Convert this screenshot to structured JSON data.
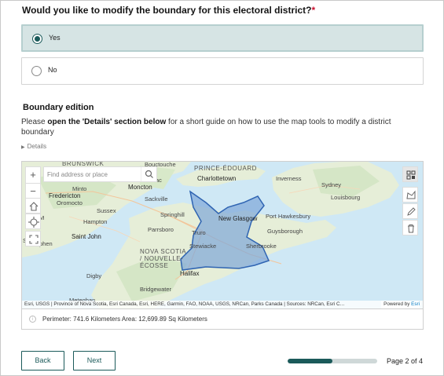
{
  "question": {
    "text": "Would you like to modify the boundary for this electoral district?",
    "required_mark": "*"
  },
  "options": [
    {
      "label": "Yes",
      "selected": true
    },
    {
      "label": "No",
      "selected": false
    }
  ],
  "section": {
    "title": "Boundary edition",
    "desc_prefix": "Please ",
    "desc_bold": "open the 'Details' section below",
    "desc_suffix": " for a short guide on how to use the map tools to modify a district boundary",
    "details_label": "Details"
  },
  "map": {
    "search_placeholder": "Find address or place",
    "labels": {
      "brunswick": "BRUNSWICK",
      "bouctouche": "Bouctouche",
      "prince_edouard": "PRINCE-ÉDOUARD",
      "charlottetown": "Charlottetown",
      "inverness": "Inverness",
      "sydney": "Sydney",
      "louisbourg": "Louisbourg",
      "moncton": "Moncton",
      "minto": "Minto",
      "fredericton": "Fredericton",
      "oromocto": "Oromocto",
      "sackville": "Sackville",
      "sussex": "Sussex",
      "springhill": "Springhill",
      "new_glasgow": "New Glasgow",
      "port_hawkesbury": "Port Hawkesbury",
      "hampton": "Hampton",
      "parrsboro": "Parrsboro",
      "truro": "Truro",
      "guysborough": "Guysborough",
      "saint_john": "Saint John",
      "stewiacke": "Stewiacke",
      "sherbrooke": "Sherbrooke",
      "nova_scotia_1": "NOVA SCOTIA",
      "nova_scotia_2": "/ NOUVELLE-",
      "nova_scotia_3": "ÉCOSSE",
      "halifax": "Halifax",
      "digby": "Digby",
      "bridgewater": "Bridgewater",
      "meteghan": "Meteghan",
      "edge_s": "S",
      "edge_m": "M",
      "edge_phen": "phen",
      "edge_ac": "ac"
    },
    "attribution": "Esri, USGS | Province of Nova Scotia, Esri Canada, Esri, HERE, Garmin, FAO, NOAA, USGS, NRCan, Parks Canada | Sources: NRCan, Esri C…",
    "powered_by": "Powered by",
    "powered_brand": "Esri",
    "zoom_in": "+",
    "zoom_out": "−"
  },
  "measurement": {
    "text": "Perimeter: 741.6 Kilometers Area: 12,699.89 Sq Kilometers",
    "info_icon": "i"
  },
  "nav": {
    "back_label": "Back",
    "next_label": "Next",
    "page_text": "Page 2 of 4",
    "progress": 0.5
  },
  "colors": {
    "accent": "#1b5a5a",
    "selected_bg": "#d6e4e4",
    "polygon_fill": "#7ea6d8",
    "polygon_stroke": "#2f64b2",
    "water": "#cfe8f5",
    "land": "#e7eedb"
  }
}
